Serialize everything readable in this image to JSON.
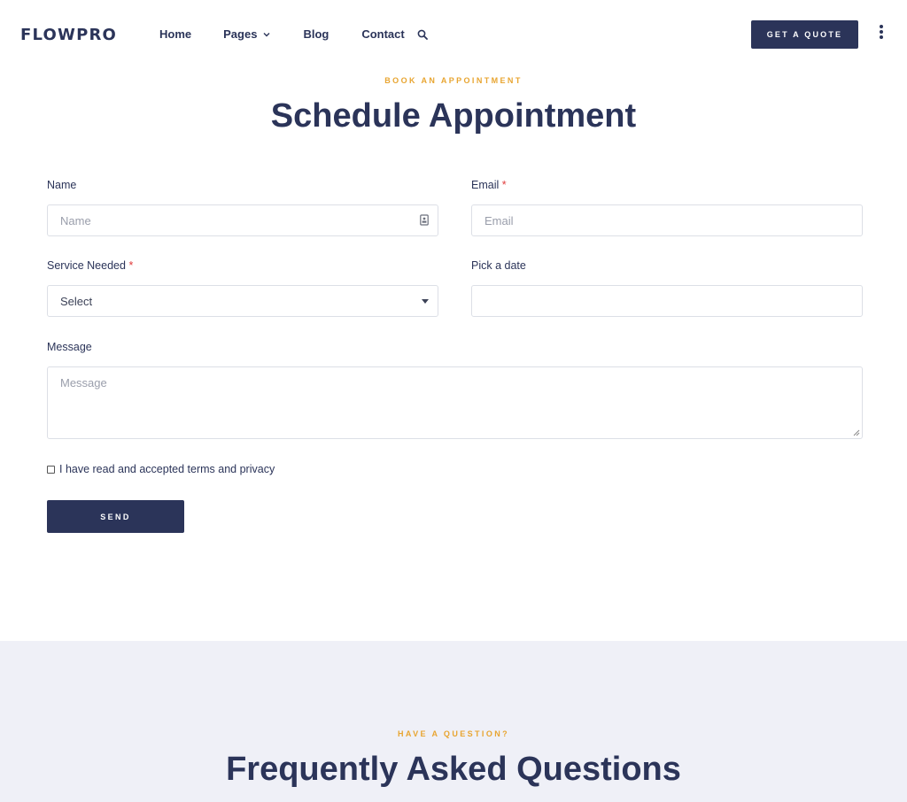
{
  "header": {
    "logo": "FLOWPRO",
    "nav": {
      "home": "Home",
      "pages": "Pages",
      "blog": "Blog",
      "contact": "Contact"
    },
    "quote_button": "GET A QUOTE"
  },
  "appointment": {
    "eyebrow": "BOOK AN APPOINTMENT",
    "title": "Schedule Appointment",
    "form": {
      "name_label": "Name",
      "name_placeholder": "Name",
      "email_label": "Email",
      "email_placeholder": "Email",
      "required_mark": "*",
      "service_label": "Service Needed",
      "service_selected": "Select",
      "date_label": "Pick a date",
      "message_label": "Message",
      "message_placeholder": "Message",
      "terms_text": "I have read and accepted terms and privacy",
      "send_label": "SEND"
    }
  },
  "faq": {
    "eyebrow": "HAVE A QUESTION?",
    "title": "Frequently Asked Questions"
  },
  "icons": {
    "search": "search-icon",
    "chevron": "chevron-down-icon",
    "menu": "kebab-menu-icon",
    "contact_card": "contact-card-icon",
    "caret": "caret-down-icon"
  },
  "colors": {
    "primary": "#2b3459",
    "accent": "#e8a531",
    "required": "#e03b3b",
    "faq_bg": "#eff0f7"
  }
}
